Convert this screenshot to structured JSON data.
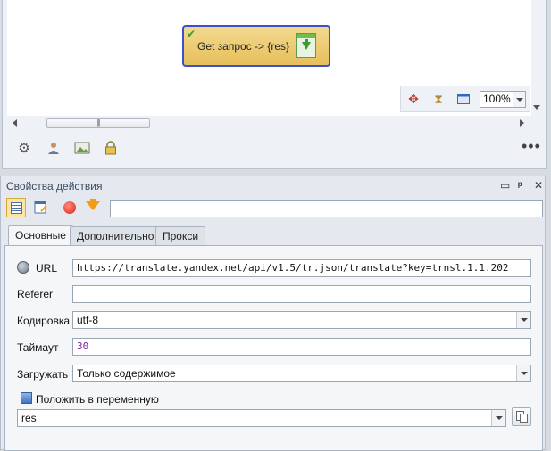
{
  "canvas": {
    "node": {
      "label": "Get запрос -> {res}"
    },
    "zoom": {
      "value": "100%"
    },
    "hscroll_grip": "|||"
  },
  "properties": {
    "title": "Свойства действия",
    "window_buttons": {
      "restore": "▭",
      "pin": "ᵖ",
      "close": "✕"
    },
    "search_value": "",
    "tabs": [
      {
        "label": "Основные",
        "active": true
      },
      {
        "label": "Дополнительно",
        "active": false
      },
      {
        "label": "Прокси",
        "active": false
      }
    ],
    "fields": {
      "url": {
        "label": "URL",
        "value": "https://translate.yandex.net/api/v1.5/tr.json/translate?key=trnsl.1.1.202"
      },
      "referer": {
        "label": "Referer",
        "value": ""
      },
      "encoding": {
        "label": "Кодировка",
        "value": "utf-8"
      },
      "timeout": {
        "label": "Таймаут",
        "value": "30"
      },
      "load": {
        "label": "Загружать",
        "value": "Только содержимое"
      },
      "save_to_var": {
        "label": "Положить в переменную",
        "checked": true
      },
      "variable": {
        "value": "res"
      }
    },
    "colors": {
      "timeout_value": "#7a1fa2",
      "accent": "#3b4fcf"
    }
  }
}
